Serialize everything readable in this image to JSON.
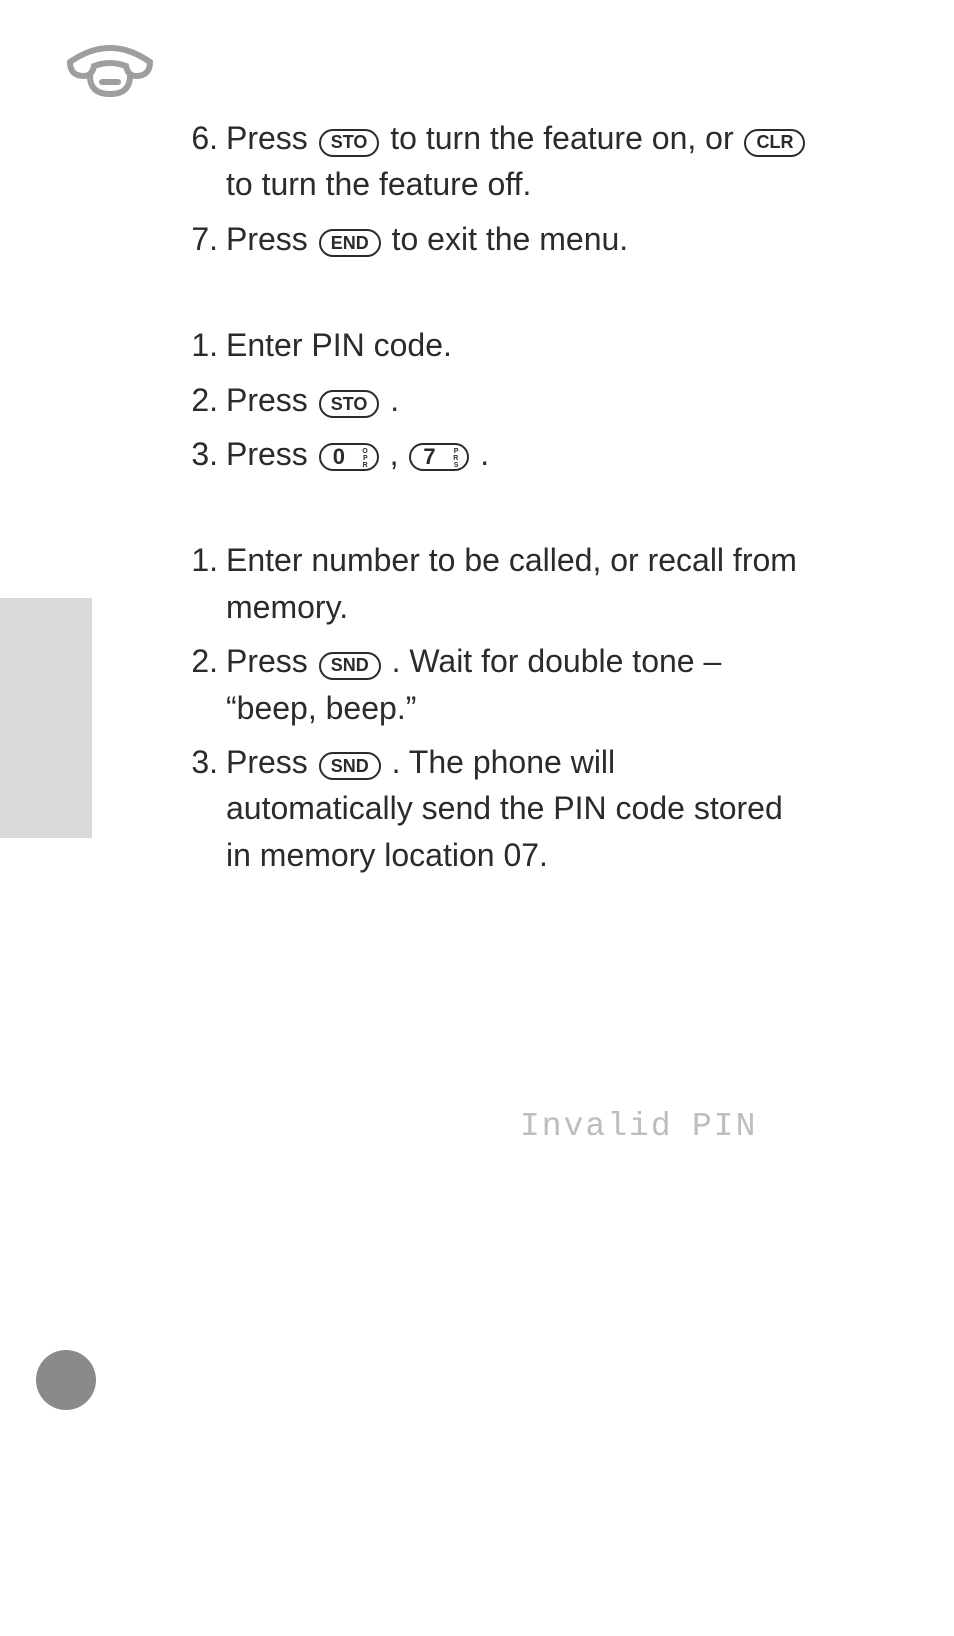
{
  "keys": {
    "sto": "STO",
    "clr": "CLR",
    "end": "END",
    "snd": "SND",
    "zero_digit": "0",
    "zero_letters": [
      "O",
      "P",
      "R"
    ],
    "seven_digit": "7",
    "seven_letters": [
      "P",
      "R",
      "S"
    ]
  },
  "sections": [
    {
      "id": "s1",
      "items": [
        {
          "n": "6.",
          "before": "Press ",
          "key": "sto",
          "mid": " to turn the feature on, or ",
          "key2": "clr",
          "after": " to turn the feature off."
        },
        {
          "n": "7.",
          "before": "Press ",
          "key": "end",
          "after": " to exit the menu."
        }
      ]
    },
    {
      "id": "s2",
      "items": [
        {
          "n": "1.",
          "plain": "Enter PIN code."
        },
        {
          "n": "2.",
          "before": "Press ",
          "key": "sto",
          "after": "."
        },
        {
          "n": "3.",
          "before": "Press ",
          "digit": "zero",
          "mid": ", ",
          "digit2": "seven",
          "after": "."
        }
      ]
    },
    {
      "id": "s3",
      "items": [
        {
          "n": "1.",
          "plain": "Enter number to be called, or recall from memory."
        },
        {
          "n": "2.",
          "before": "Press ",
          "key": "snd",
          "after": ". Wait for double tone – “beep, beep.”"
        },
        {
          "n": "3.",
          "before": "Press ",
          "key": "snd",
          "after": ". The phone will automatically send the PIN code stored in memory location 07."
        }
      ]
    }
  ],
  "status": {
    "invalid_pin_1": "Invalid",
    "invalid_pin_2": "PIN"
  }
}
